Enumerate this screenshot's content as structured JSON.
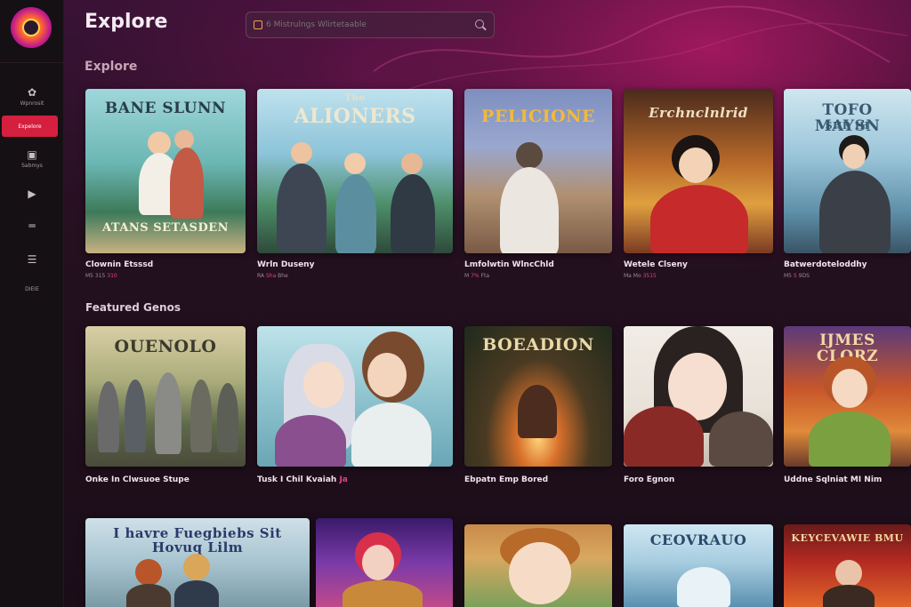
{
  "app": {
    "page_title": "Explore",
    "search_placeholder": "6 Mistrulngs Wlirtetaable"
  },
  "sidebar": {
    "brand_label": "Wpnrosit",
    "items": [
      {
        "label": "Expelore",
        "icon": "fire-icon"
      },
      {
        "label": "Sabmys",
        "icon": "play-square-icon"
      },
      {
        "label": "",
        "icon": "play-icon"
      },
      {
        "label": "",
        "icon": "lines-icon"
      },
      {
        "label": "",
        "icon": "menu-icon"
      },
      {
        "label": "DIEIE",
        "icon": "text-icon"
      }
    ]
  },
  "sections": {
    "explore_label": "Explore",
    "featured_label": "Featured Genos"
  },
  "row1": [
    {
      "art_title": "BANE SLUNN",
      "art_sub": "ATANS  SETASDEN",
      "caption": "Clownin Etsssd",
      "meta_a": "M5",
      "meta_b": "315",
      "meta_c": "310"
    },
    {
      "art_title": "ALIONERS",
      "art_sub": "Tho",
      "caption": "Wrln Duseny",
      "meta_a": "RA",
      "meta_b": "Sha",
      "meta_c": "Bhe"
    },
    {
      "art_title": "PELICIONE",
      "art_sub": "",
      "caption": "Lmfolwtin WlncChld",
      "meta_a": "M",
      "meta_b": "7%",
      "meta_c": "Fta"
    },
    {
      "art_title": "Erchnclnlrid",
      "art_sub": "",
      "caption": "Wetele Clseny",
      "meta_a": "Ma",
      "meta_b": "Mo",
      "meta_c": "3515"
    },
    {
      "art_title": "TOFO MAYSN",
      "art_sub": "SHR IH",
      "caption": "Batwerdoteloddhy",
      "meta_a": "M5",
      "meta_b": "S",
      "meta_c": "9DS"
    }
  ],
  "row2": [
    {
      "art_title": "OUENOLO",
      "art_sub": "",
      "caption": "Onke In Clwsuoe Stupe",
      "meta_a": "",
      "meta_b": "",
      "meta_c": ""
    },
    {
      "art_title": "",
      "art_sub": "",
      "caption": "Tusk I Chil Kvaiah",
      "meta_a": "Ja",
      "meta_b": "",
      "meta_c": ""
    },
    {
      "art_title": "BOEADION",
      "art_sub": "",
      "caption": "Ebpatn Emp Bored",
      "meta_a": "",
      "meta_b": "",
      "meta_c": ""
    },
    {
      "art_title": "",
      "art_sub": "",
      "caption": "Foro Egnon",
      "meta_a": "",
      "meta_b": "",
      "meta_c": ""
    },
    {
      "art_title": "IJMES CLORZ",
      "art_sub": "",
      "caption": "Uddne Sqlniat MI Nim",
      "meta_a": "",
      "meta_b": "",
      "meta_c": ""
    }
  ],
  "row3": [
    {
      "art_title": "I havre Fuegbiebs  Sit  Hovuq Lilm"
    },
    {
      "art_title": ""
    },
    {
      "art_title": ""
    },
    {
      "art_title": "CEOVRAUO"
    },
    {
      "art_title": "KEYCEVAWIE BMU"
    }
  ],
  "colors": {
    "accent": "#d41f3f",
    "background": "#1a0f1c",
    "meta_highlight": "#e2418a"
  }
}
